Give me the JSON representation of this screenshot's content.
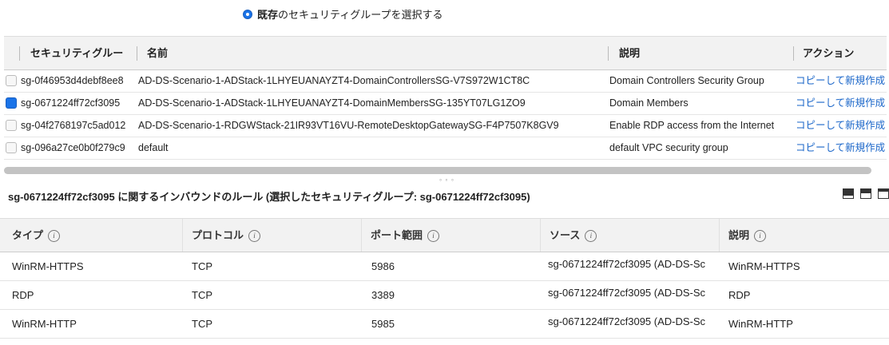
{
  "radio": {
    "bold": "既存",
    "rest": "のセキュリティグループを選択する"
  },
  "sg_table": {
    "headers": {
      "sg": "セキュリティグルー",
      "name": "名前",
      "desc": "説明",
      "action": "アクション"
    },
    "rows": [
      {
        "id": "sg-0f46953d4debf8ee8",
        "name": "AD-DS-Scenario-1-ADStack-1LHYEUANAYZT4-DomainControllersSG-V7S972W1CT8C",
        "desc": "Domain Controllers Security Group",
        "action": "コピーして新規作成",
        "checked": false
      },
      {
        "id": "sg-0671224ff72cf3095",
        "name": "AD-DS-Scenario-1-ADStack-1LHYEUANAYZT4-DomainMembersSG-135YT07LG1ZO9",
        "desc": "Domain Members",
        "action": "コピーして新規作成",
        "checked": true
      },
      {
        "id": "sg-04f2768197c5ad012",
        "name": "AD-DS-Scenario-1-RDGWStack-21IR93VT16VU-RemoteDesktopGatewaySG-F4P7507K8GV9",
        "desc": "Enable RDP access from the Internet",
        "action": "コピーして新規作成",
        "checked": false
      },
      {
        "id": "sg-096a27ce0b0f279c9",
        "name": "default",
        "desc": "default VPC security group",
        "action": "コピーして新規作成",
        "checked": false
      }
    ]
  },
  "rules_title": "sg-0671224ff72cf3095 に関するインバウンドのルール (選択したセキュリティグループ: sg-0671224ff72cf3095)",
  "rules": {
    "headers": {
      "type": "タイプ",
      "protocol": "プロトコル",
      "port": "ポート範囲",
      "source": "ソース",
      "desc": "説明"
    },
    "info_glyph": "i",
    "rows": [
      {
        "type": "WinRM-HTTPS",
        "protocol": "TCP",
        "port": "5986",
        "source": "sg-0671224ff72cf3095 (AD-DS-Sc",
        "desc": "WinRM-HTTPS"
      },
      {
        "type": "RDP",
        "protocol": "TCP",
        "port": "3389",
        "source": "sg-0671224ff72cf3095 (AD-DS-Sc",
        "desc": "RDP"
      },
      {
        "type": "WinRM-HTTP",
        "protocol": "TCP",
        "port": "5985",
        "source": "sg-0671224ff72cf3095 (AD-DS-Sc",
        "desc": "WinRM-HTTP"
      }
    ]
  },
  "colors": {
    "accent": "#1a73e8",
    "link": "#1a66c9"
  }
}
